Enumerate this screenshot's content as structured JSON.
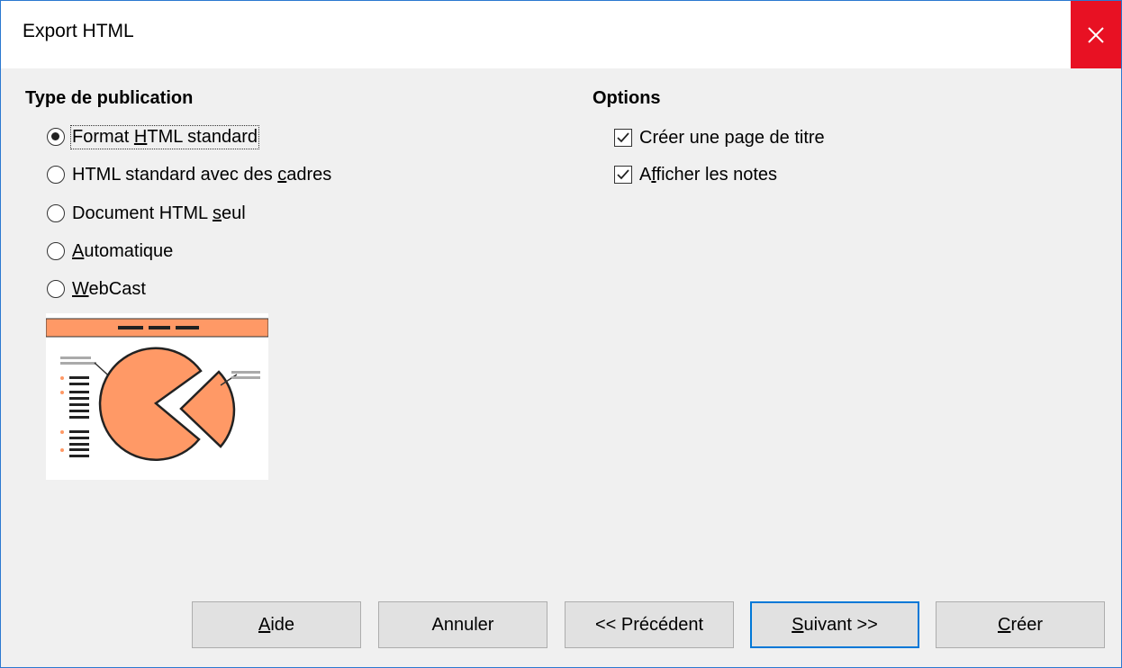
{
  "window": {
    "title": "Export HTML"
  },
  "publication": {
    "heading": "Type de publication",
    "options": [
      {
        "label": "Format HTML standard",
        "selected": true
      },
      {
        "label": "HTML standard avec des cadres",
        "selected": false
      },
      {
        "label": "Document HTML seul",
        "selected": false
      },
      {
        "label": "Automatique",
        "selected": false
      },
      {
        "label": "WebCast",
        "selected": false
      }
    ]
  },
  "options": {
    "heading": "Options",
    "checks": [
      {
        "label": "Créer une page de titre",
        "checked": true
      },
      {
        "label": "Afficher les notes",
        "checked": true
      }
    ]
  },
  "buttons": {
    "help": "Aide",
    "cancel": "Annuler",
    "previous": "<< Précédent",
    "next": "Suivant >>",
    "create": "Créer"
  },
  "colors": {
    "accent": "#0078d7",
    "close": "#e81123",
    "preview_orange": "#ff9966"
  },
  "icons": {
    "close": "close-icon",
    "preview": "presentation-preview-image"
  }
}
